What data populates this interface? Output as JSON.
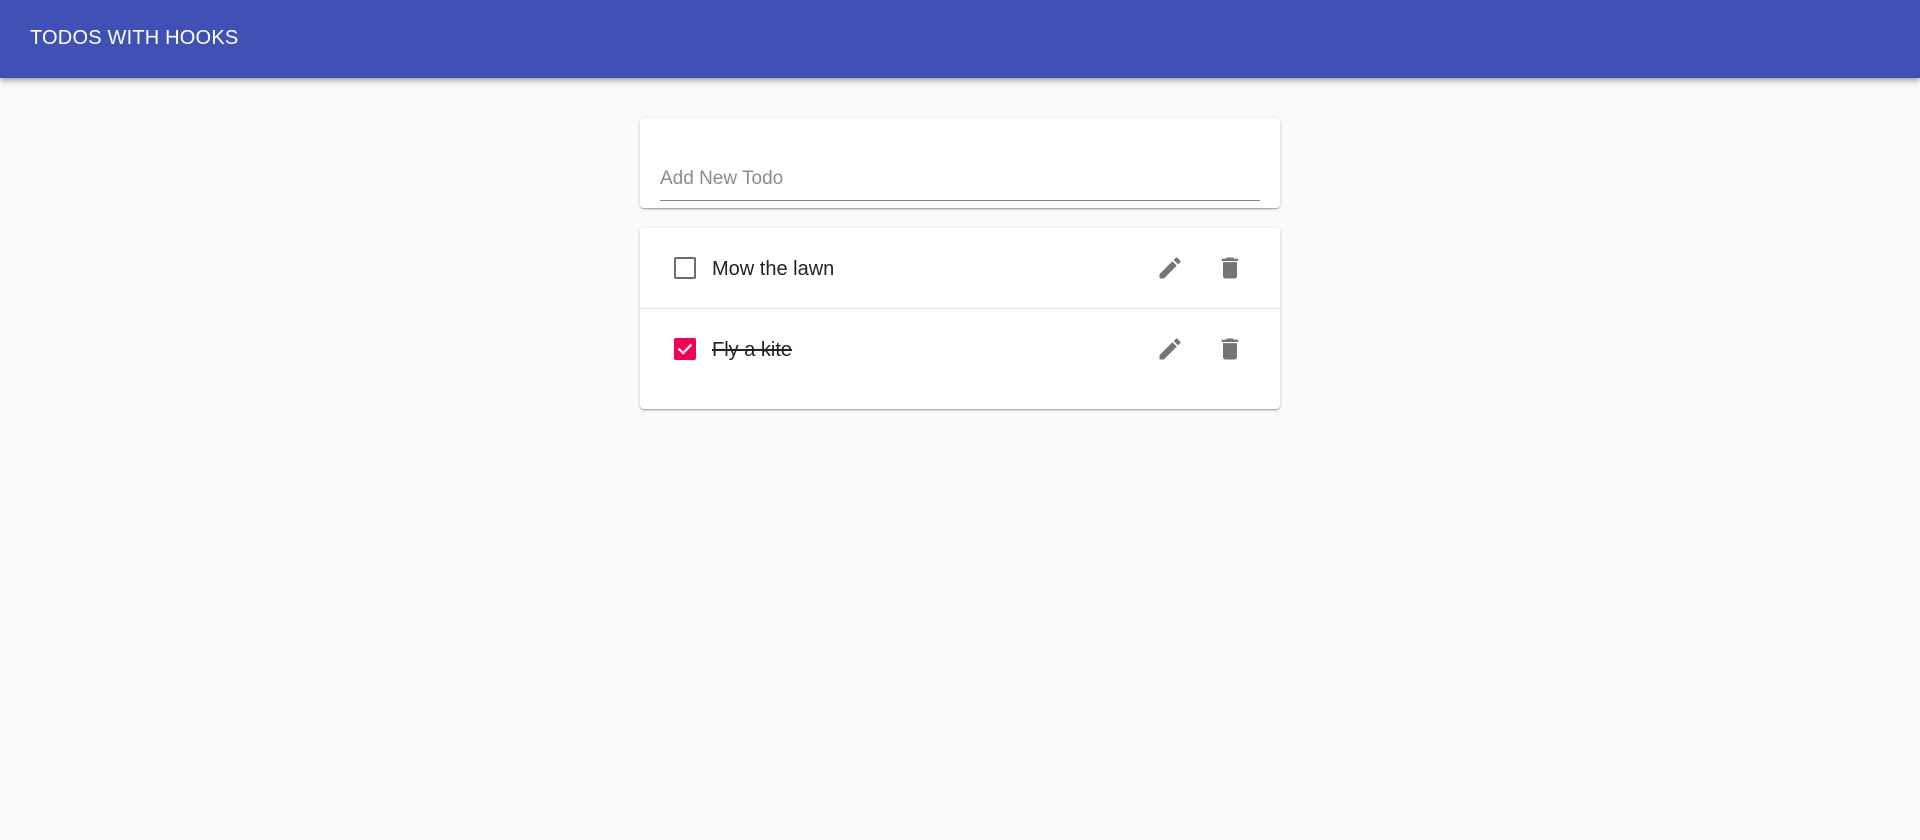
{
  "appbar": {
    "title": "TODOS WITH HOOKS",
    "color": "#3f51b5"
  },
  "new_todo": {
    "placeholder": "Add New Todo",
    "value": ""
  },
  "todos": [
    {
      "text": "Mow the lawn",
      "completed": false
    },
    {
      "text": "Fly a kite",
      "completed": true
    }
  ],
  "icons": {
    "edit": "pencil-icon",
    "delete": "trash-icon",
    "check": "checkmark-icon"
  },
  "colors": {
    "checkbox_checked": "#f50057",
    "icon": "#757575",
    "background": "#fafafa"
  }
}
